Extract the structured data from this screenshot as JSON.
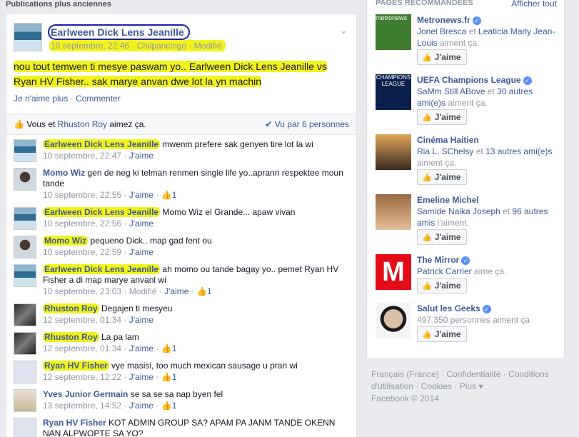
{
  "left": {
    "section_header": "Publications plus anciennes",
    "post": {
      "author": "Earlween Dick Lens Jeanille",
      "meta": "10 septembre, 22:46 · Chilpancingo · Modifié",
      "text_line1": "nou tout temwen ti mesye paswam yo.. Earlween Dick Lens Jeanille vs",
      "text_line2": "Ryan HV Fisher.. sak marye anvan dwe lot la yn machin",
      "actions": {
        "unlike": "Je n'aime plus",
        "sep": " · ",
        "comment": "Commenter"
      },
      "likes_text_prefix": "Vous et ",
      "likes_person": "Rhuston Roy",
      "likes_text_suffix": " aimez ça.",
      "seen_by": "Vu par 6 personnes",
      "chevron": "⌄"
    },
    "comments": [
      {
        "name": "Earlween Dick Lens Jeanille",
        "text": " mwenm prefere sak genyen tire lot la wi",
        "time": "10 septembre, 22:47",
        "extra": "",
        "like": "J'aime",
        "likes": ""
      },
      {
        "name": "Momo Wiz",
        "text": " gen de neg ki telman renmen single life yo..aprann respektee moun tande",
        "time": "10 septembre, 22:55",
        "extra": "",
        "like": "J'aime",
        "likes": "1"
      },
      {
        "name": "Earlween Dick Lens Jeanille",
        "text": " Momo Wiz el Grande... apaw vivan",
        "time": "10 septembre, 22:56",
        "extra": "",
        "like": "J'aime",
        "likes": ""
      },
      {
        "name": "Momo Wiz",
        "text": " pequeno Dick.. map gad fent ou",
        "time": "10 septembre, 22:59",
        "extra": "",
        "like": "J'aime",
        "likes": ""
      },
      {
        "name": "Earlween Dick Lens Jeanille",
        "text": " ah momo ou tande bagay yo.. pemet Ryan HV Fisher a di map marye anvanl wi",
        "time": "10 septembre, 23:03",
        "extra": "Modifié",
        "like": "J'aime",
        "likes": "1"
      },
      {
        "name": "Rhuston Roy",
        "text": " Degajen ti mesyeu",
        "time": "12 septembre, 01:34",
        "extra": "",
        "like": "J'aime",
        "likes": ""
      },
      {
        "name": "Rhuston Roy",
        "text": " La pa lam",
        "time": "12 septembre, 01:34",
        "extra": "",
        "like": "J'aime",
        "likes": "1"
      },
      {
        "name": "Ryan HV Fisher",
        "text": " vye masisi, too much mexican sausage u pran wi",
        "time": "12 septembre, 12:22",
        "extra": "",
        "like": "J'aime",
        "likes": "1"
      },
      {
        "name": "Yves Junior Germain",
        "text": " se sa se sa nap byen fel",
        "time": "13 septembre, 14:52",
        "extra": "",
        "like": "J'aime",
        "likes": "1"
      },
      {
        "name": "Ryan HV Fisher",
        "text": " KOT ADMIN GROUP SA? APAM PA JANM TANDE OKENN NAN ALPWOPTE SA YO?",
        "time": "",
        "extra": "",
        "like": "",
        "likes": ""
      }
    ]
  },
  "right": {
    "title": "Pages recommandées",
    "see_all": "Afficher tout",
    "like_label": "J'aime",
    "pages": [
      {
        "name": "Metronews.fr",
        "verified": true,
        "sub_a": "Jonel Bresca",
        "sub_mid": " et ",
        "sub_b": "Leaticia Marly Jean-Louis",
        "sub_end": " aiment ça.",
        "thumb_text": "metronews"
      },
      {
        "name": "UEFA Champions League",
        "verified": true,
        "sub_a": "SaMm Still ABove",
        "sub_mid": " et ",
        "sub_b": "30 autres ami(e)s",
        "sub_end": " aiment ça.",
        "thumb_text": "CHAMPIONS LEAGUE"
      },
      {
        "name": "Cinéma Haitien",
        "verified": false,
        "sub_a": "Ria L. SChelsy",
        "sub_mid": " et ",
        "sub_b": "13 autres ami(e)s",
        "sub_end": " aiment ça.",
        "thumb_text": ""
      },
      {
        "name": "Emeline Michel",
        "verified": false,
        "sub_a": "Samide Naika Joseph",
        "sub_mid": " et ",
        "sub_b": "96 autres amis",
        "sub_end": " l'aiment.",
        "thumb_text": ""
      },
      {
        "name": "The Mirror",
        "verified": true,
        "sub_a": "Patrick Carrier",
        "sub_mid": "",
        "sub_b": "",
        "sub_end": " aime ça.",
        "thumb_text": "M"
      },
      {
        "name": "Salut les Geeks",
        "verified": true,
        "sub_a": "",
        "sub_mid": "",
        "sub_b": "",
        "sub_end": "497 350 personnes aiment ça",
        "thumb_text": ""
      }
    ]
  },
  "footer": {
    "line1_a": "Français (France)",
    "line1_b": "Confidentialité",
    "line1_c": "Conditions",
    "line2_a": "d'utilisation",
    "line2_b": "Cookies",
    "line2_c": "Plus",
    "copyright": "Facebook © 2014"
  },
  "colors": {
    "link": "#3b5998",
    "highlight": "#f3f31c",
    "circle": "#1b22a8",
    "meta": "#9197a3"
  }
}
